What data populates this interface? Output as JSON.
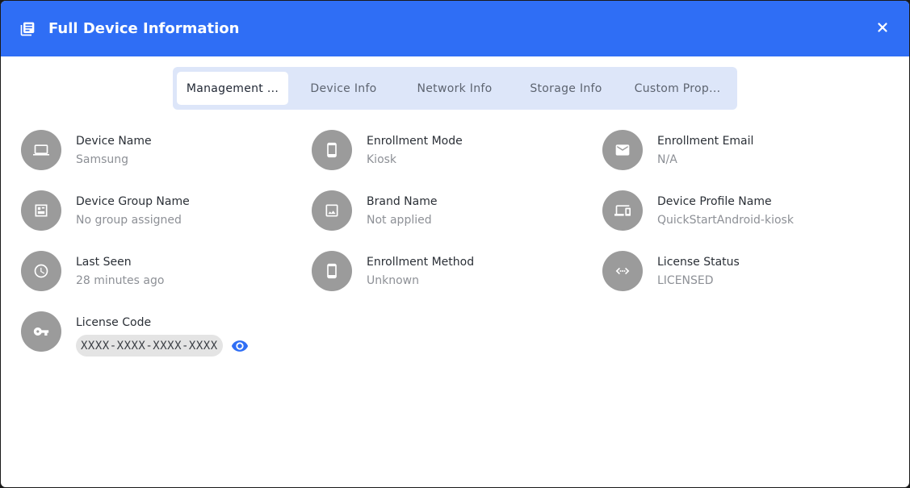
{
  "dialog": {
    "title": "Full Device Information",
    "header_color": "#2f6ef5"
  },
  "tabs": [
    {
      "label": "Management ...",
      "active": true
    },
    {
      "label": "Device Info",
      "active": false
    },
    {
      "label": "Network Info",
      "active": false
    },
    {
      "label": "Storage Info",
      "active": false
    },
    {
      "label": "Custom Prop...",
      "active": false
    }
  ],
  "fields": {
    "device_name": {
      "label": "Device Name",
      "value": "Samsung",
      "icon": "laptop-icon"
    },
    "enrollment_mode": {
      "label": "Enrollment Mode",
      "value": "Kiosk",
      "icon": "phone-icon"
    },
    "enrollment_email": {
      "label": "Enrollment Email",
      "value": "N/A",
      "icon": "mail-icon"
    },
    "device_group_name": {
      "label": "Device Group Name",
      "value": "No group assigned",
      "icon": "group-icon"
    },
    "brand_name": {
      "label": "Brand Name",
      "value": "Not applied",
      "icon": "image-icon"
    },
    "device_profile_name": {
      "label": "Device Profile Name",
      "value": "QuickStartAndroid-kiosk",
      "icon": "devices-icon"
    },
    "last_seen": {
      "label": "Last Seen",
      "value": "28 minutes ago",
      "icon": "clock-icon"
    },
    "enrollment_method": {
      "label": "Enrollment Method",
      "value": "Unknown",
      "icon": "phone-icon"
    },
    "license_status": {
      "label": "License Status",
      "value": "LICENSED",
      "icon": "code-arrows-icon"
    },
    "license_code": {
      "label": "License Code",
      "value": "XXXX-XXXX-XXXX-XXXX",
      "icon": "key-icon"
    }
  },
  "colors": {
    "accent": "#2f6ef5",
    "avatar_bg": "#9b9b9b",
    "tabs_bg": "#dde6f9"
  }
}
